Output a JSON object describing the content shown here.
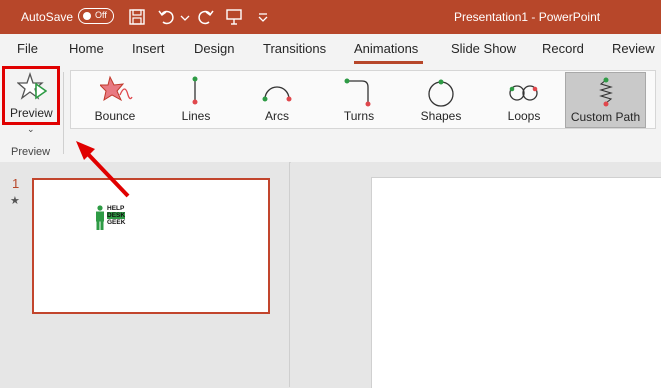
{
  "titlebar": {
    "autosave_label": "AutoSave",
    "autosave_state": "Off",
    "doc_title": "Presentation1  -  PowerPoint"
  },
  "tabs": [
    {
      "label": "File"
    },
    {
      "label": "Home"
    },
    {
      "label": "Insert"
    },
    {
      "label": "Design"
    },
    {
      "label": "Transitions"
    },
    {
      "label": "Animations"
    },
    {
      "label": "Slide Show"
    },
    {
      "label": "Record"
    },
    {
      "label": "Review"
    }
  ],
  "active_tab": "Animations",
  "preview": {
    "button_label": "Preview",
    "group_label": "Preview"
  },
  "effects": [
    {
      "label": "Bounce"
    },
    {
      "label": "Lines"
    },
    {
      "label": "Arcs"
    },
    {
      "label": "Turns"
    },
    {
      "label": "Shapes"
    },
    {
      "label": "Loops"
    },
    {
      "label": "Custom Path"
    }
  ],
  "selected_effect": "Custom Path",
  "slides": [
    {
      "number": "1",
      "has_animation_marker": "★"
    }
  ],
  "logo_text": [
    "HELP",
    "DESK",
    "GEEK"
  ],
  "colors": {
    "accent": "#b7472a",
    "highlight": "#e00000",
    "effect_green": "#2e9b45",
    "effect_red": "#e0474c"
  }
}
